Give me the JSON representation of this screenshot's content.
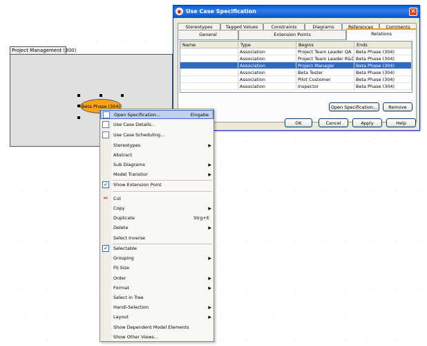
{
  "diagram": {
    "package_label": "Project Management (300)",
    "usecase_label": "Beta Phase (304)",
    "edit_hint": "Ed"
  },
  "dialog": {
    "title": "Use Case Specification",
    "close_glyph": "✕",
    "tabs_back": [
      "Stereotypes",
      "Tagged Values",
      "Constraints",
      "Diagrams",
      "References",
      "Comments"
    ],
    "tabs_front": [
      "General",
      "Extension Points",
      "Relations"
    ],
    "active_tab": "Relations",
    "table": {
      "columns": [
        "Name",
        "Type",
        "Begins",
        "Ends"
      ],
      "rows": [
        {
          "name": "",
          "type": "Association",
          "begins": "Project Team Leader QA",
          "ends": "Beta Phase (304)"
        },
        {
          "name": "",
          "type": "Association",
          "begins": "Project Team Leader R&D",
          "ends": "Beta Phase (304)"
        },
        {
          "name": "",
          "type": "Association",
          "begins": "Project Manager",
          "ends": "Beta Phase (304)"
        },
        {
          "name": "",
          "type": "Association",
          "begins": "Beta Tester",
          "ends": "Beta Phase (304)"
        },
        {
          "name": "",
          "type": "Association",
          "begins": "Pilot Customer",
          "ends": "Beta Phase (304)"
        },
        {
          "name": "",
          "type": "Association",
          "begins": "Inspector",
          "ends": "Beta Phase (304)"
        }
      ],
      "selected_row": 2
    },
    "buttons": {
      "open_spec": "Open Specification...",
      "remove": "Remove",
      "ok": "OK",
      "cancel": "Cancel",
      "apply": "Apply",
      "help": "Help"
    }
  },
  "context_menu": {
    "items": [
      {
        "label": "Open Specification...",
        "shortcut": "Eingabe",
        "icon": "document-icon",
        "highlight": true
      },
      {
        "label": "Use Case Details...",
        "icon": "document-icon"
      },
      {
        "label": "Use Case Scheduling...",
        "icon": "document-icon"
      },
      {
        "label": "Stereotypes",
        "submenu": true
      },
      {
        "label": "Abstract"
      },
      {
        "label": "Sub Diagrams",
        "submenu": true
      },
      {
        "label": "Model Transitor",
        "submenu": true
      },
      {
        "separator": true
      },
      {
        "label": "Show Extension Point",
        "checked": true
      },
      {
        "separator": true
      },
      {
        "label": "Cut",
        "icon": "scissors-icon"
      },
      {
        "label": "Copy",
        "submenu": true
      },
      {
        "label": "Duplicate",
        "shortcut": "Strg+E"
      },
      {
        "label": "Delete",
        "submenu": true
      },
      {
        "label": "Select Inverse"
      },
      {
        "separator": true
      },
      {
        "label": "Selectable",
        "checked": true
      },
      {
        "label": "Grouping",
        "submenu": true
      },
      {
        "label": "Fit Size"
      },
      {
        "label": "Order",
        "submenu": true
      },
      {
        "label": "Format",
        "submenu": true
      },
      {
        "label": "Select in Tree"
      },
      {
        "label": "Handi-Selection",
        "submenu": true
      },
      {
        "label": "Layout",
        "submenu": true
      },
      {
        "label": "Show Dependent Model Elements"
      },
      {
        "label": "Show Other Views..."
      }
    ]
  },
  "colors": {
    "accent": "#316ac5",
    "usecase_fill": "#f7a21b",
    "title_bar": "#0a5ad8"
  }
}
